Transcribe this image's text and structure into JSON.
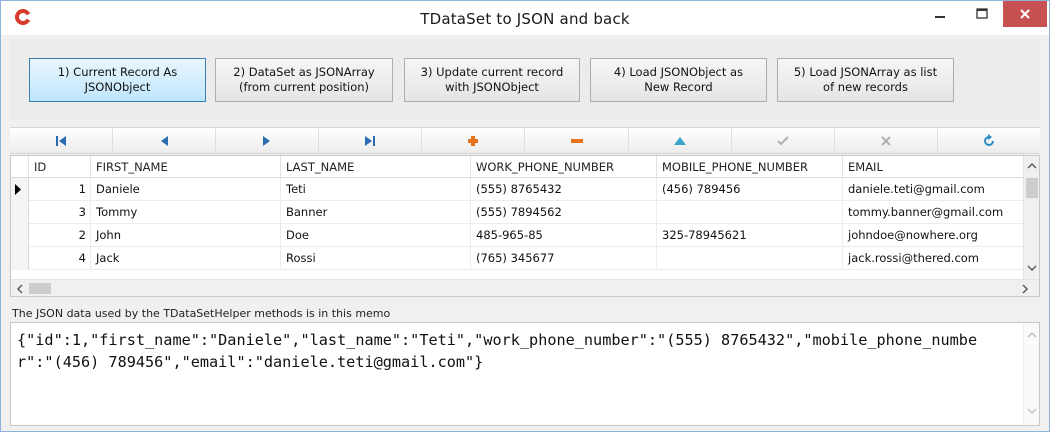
{
  "window": {
    "title": "TDataSet to JSON and back",
    "accent_close": "#c75050"
  },
  "actions": [
    {
      "line1": "1) Current Record As",
      "line2": "JSONObject"
    },
    {
      "line1": "2) DataSet as JSONArray",
      "line2": "(from current position)"
    },
    {
      "line1": "3) Update current record",
      "line2": "with JSONObject"
    },
    {
      "line1": "4) Load JSONObject as",
      "line2": "New Record"
    },
    {
      "line1": "5) Load JSONArray as list",
      "line2": "of new records"
    }
  ],
  "navigator": {
    "buttons": [
      "first-icon",
      "prior-icon",
      "next-icon",
      "last-icon",
      "insert-icon",
      "delete-icon",
      "edit-icon",
      "post-icon",
      "cancel-icon",
      "refresh-icon"
    ]
  },
  "grid": {
    "columns": [
      "ID",
      "FIRST_NAME",
      "LAST_NAME",
      "WORK_PHONE_NUMBER",
      "MOBILE_PHONE_NUMBER",
      "EMAIL"
    ],
    "rows": [
      {
        "id": "1",
        "first_name": "Daniele",
        "last_name": "Teti",
        "work": "(555) 8765432",
        "mobile": "(456) 789456",
        "email": "daniele.teti@gmail.com",
        "current": true
      },
      {
        "id": "3",
        "first_name": "Tommy",
        "last_name": "Banner",
        "work": "(555) 7894562",
        "mobile": "",
        "email": "tommy.banner@gmail.com",
        "current": false
      },
      {
        "id": "2",
        "first_name": "John",
        "last_name": "Doe",
        "work": "485-965-85",
        "mobile": "325-78945621",
        "email": "johndoe@nowhere.org",
        "current": false
      },
      {
        "id": "4",
        "first_name": "Jack",
        "last_name": "Rossi",
        "work": "(765) 345677",
        "mobile": "",
        "email": "jack.rossi@thered.com",
        "current": false
      }
    ]
  },
  "memo": {
    "label": "The JSON data used by the TDataSetHelper methods is in this memo",
    "content": "{\"id\":1,\"first_name\":\"Daniele\",\"last_name\":\"Teti\",\"work_phone_number\":\"(555) 8765432\",\"mobile_phone_number\":\"(456) 789456\",\"email\":\"daniele.teti@gmail.com\"}"
  }
}
